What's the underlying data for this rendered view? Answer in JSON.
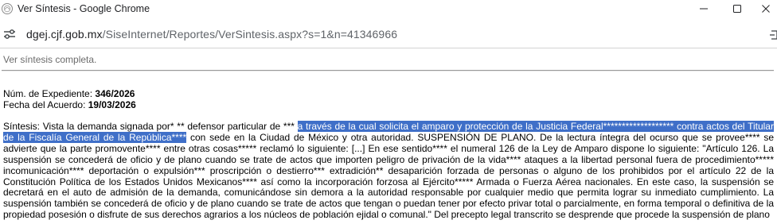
{
  "window": {
    "title": "Ver Síntesis - Google Chrome",
    "minimize_icon": "minimize-icon",
    "maximize_icon": "maximize-icon",
    "close_icon": "close-icon"
  },
  "address_bar": {
    "host": "dgej.cjf.gob.mx",
    "path": "/SiseInternet/Reportes/VerSintesis.aspx?s=1&n=41346966",
    "site_info_icon": "tune-icon"
  },
  "page": {
    "see_full_link": "Ver síntesis completa.",
    "expediente_label": "Núm. de Expediente:",
    "expediente_value": "346/2026",
    "fecha_label": "Fecha del Acuerdo:",
    "fecha_value": "19/03/2026",
    "sintesis_before": "Síntesis: Vista la demanda signada por* ** defensor particular de *** ",
    "sintesis_highlight": "a través de la cual solicita el amparo y protección de la Justicia Federal******************* contra actos del Titular de la Fiscalía General de la República****",
    "sintesis_after": " con sede en la Ciudad de México y otra autoridad. SUSPENSIÓN DE PLANO. De la lectura íntegra del ocurso que se provee**** se advierte que la parte promovente**** entre otras cosas***** reclamó lo siguiente: [...] En ese sentido**** el numeral 126 de la Ley de Amparo dispone lo siguiente: \"Artículo 126. La suspensión se concederá de oficio y de plano cuando se trate de actos que importen peligro de privación de la vida**** ataques a la libertad personal fuera de procedimiento***** incomunicación**** deportación o expulsión*** proscripción o destierro*** extradición** desaparición forzada de personas o alguno de los prohibidos por el artículo 22 de la Constitución Política de los Estados Unidos Mexicanos**** así como la incorporación forzosa al Ejército***** Armada o Fuerza Aérea nacionales. En este caso, la suspensión se decretará en el auto de admisión de la demanda, comunicándose sin demora a la autoridad responsable por cualquier medio que permita lograr su inmediato cumplimiento. La suspensión también se concederá de oficio y de plano cuando se trate de actos que tengan o puedan tener por efecto privar total o parcialmente, en forma temporal o definitiva de la propiedad posesión o disfrute de sus derechos agrarios a los núcleos de población ejidal o comunal.\" Del precepto legal transcrito se desprende que procede la suspensión de plano"
  },
  "colors": {
    "selection": "#3f6fc8",
    "link_muted": "#6b6b6b"
  }
}
